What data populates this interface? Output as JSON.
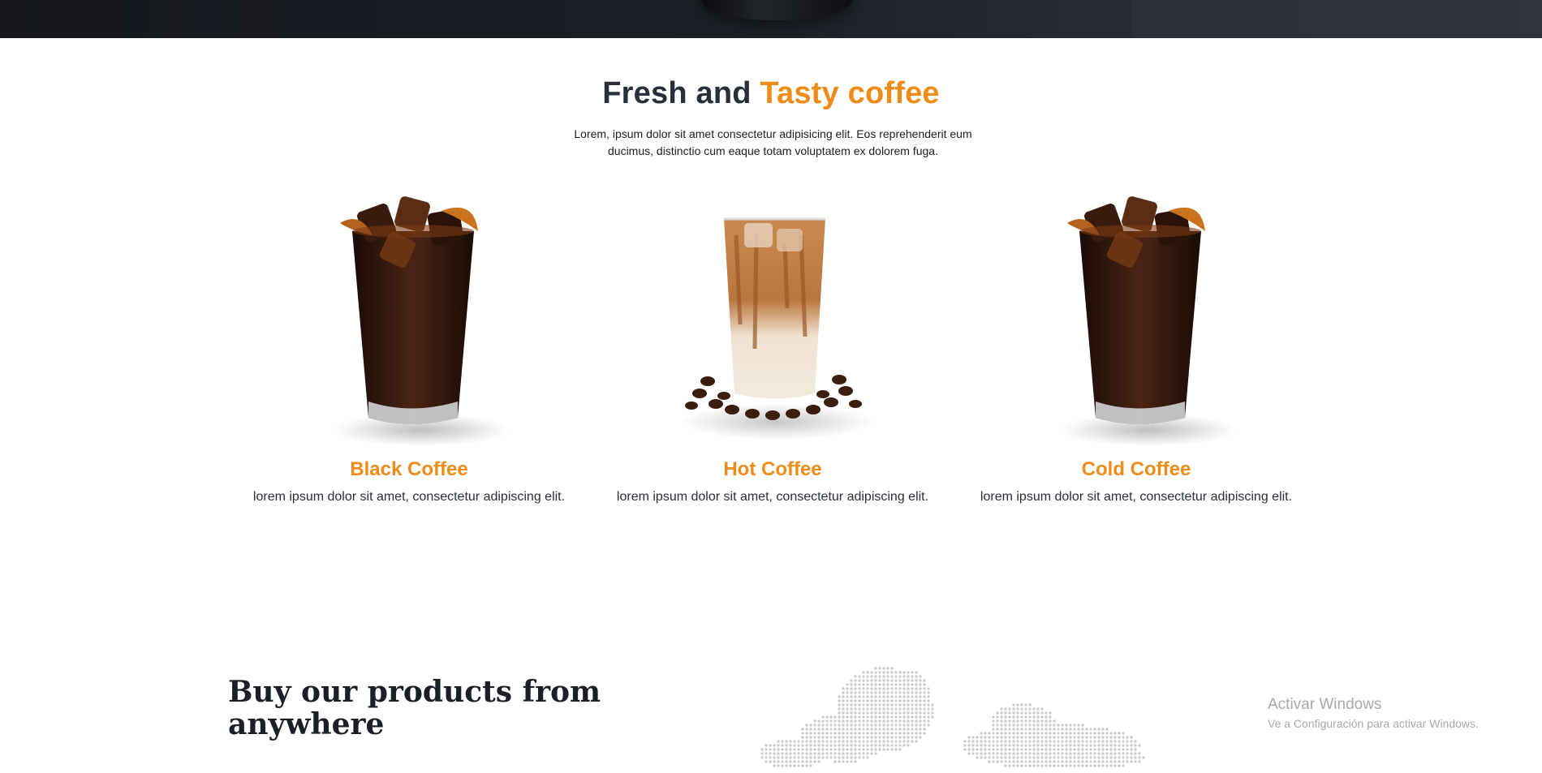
{
  "hero": {
    "title_part1": "Fresh and",
    "title_part2": "Tasty coffee"
  },
  "intro": {
    "description": "Lorem, ipsum dolor sit amet consectetur adipisicing elit. Eos reprehenderit eum ducimus, distinctio cum eaque totam voluptatem ex dolorem fuga."
  },
  "products": [
    {
      "name": "Black Coffee",
      "description": "lorem ipsum dolor sit amet, consectetur adipiscing elit.",
      "image": "iced-black-coffee-glass"
    },
    {
      "name": "Hot Coffee",
      "description": "lorem ipsum dolor sit amet, consectetur adipiscing elit.",
      "image": "iced-latte-glass-with-beans"
    },
    {
      "name": "Cold Coffee",
      "description": "lorem ipsum dolor sit amet, consectetur adipiscing elit.",
      "image": "iced-black-coffee-glass"
    }
  ],
  "buy_section": {
    "heading": "Buy our products from anywhere",
    "map": "dotted-world-map"
  },
  "os_watermark": {
    "title": "Activar Windows",
    "subtitle": "Ve a Configuración para activar Windows."
  },
  "colors": {
    "accent": "#ef8b17",
    "dark_text": "#2a2e3a",
    "banner": "#1c1f26",
    "map_dots": "#c8c8c8"
  }
}
